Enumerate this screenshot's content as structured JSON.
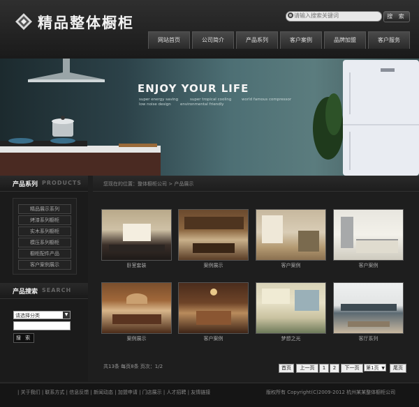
{
  "header": {
    "site_title": "精品整体橱柜",
    "search_placeholder": "请输入搜索关键词",
    "search_button": "搜 索",
    "nav": [
      "网站首页",
      "公司简介",
      "产品系列",
      "客户案例",
      "品牌加盟",
      "客户服务"
    ]
  },
  "banner": {
    "headline": "ENJOY YOUR LIFE",
    "features_line1": [
      "super energy saving",
      "super tropical cooling",
      "world famous compressor"
    ],
    "features_line2": [
      "low noise design",
      "environmental friendly"
    ]
  },
  "sidebar": {
    "products_title": "产品系列",
    "products_title_en": "PRODUCTS",
    "categories": [
      "精品展示系列",
      "烤漆系列橱柜",
      "实木系列橱柜",
      "模压系列橱柜",
      "橱柜配件产品",
      "客户案例展示"
    ],
    "search_title": "产品搜索",
    "search_title_en": "SEARCH",
    "select_placeholder": "请选择分类",
    "search_button": "搜 索"
  },
  "main": {
    "breadcrumb": "您现在的位置：整体橱柜公司 > 产品展示",
    "products": [
      {
        "caption": "卧室套装"
      },
      {
        "caption": "案例展示"
      },
      {
        "caption": "客户案例"
      },
      {
        "caption": "客户案例"
      },
      {
        "caption": "案例展示"
      },
      {
        "caption": "客户案例"
      },
      {
        "caption": "梦想之光"
      },
      {
        "caption": "客厅系列"
      }
    ],
    "pagination": {
      "info": "共13条  每页8条  页次：1/2",
      "first": "首页",
      "prev": "上一页",
      "page1": "1",
      "page2": "2",
      "next": "下一页",
      "page_select": "第1页",
      "last": "尾页"
    }
  },
  "footer": {
    "links": [
      "关于我们",
      "联系方式",
      "信息反馈",
      "新闻动态",
      "加盟申请",
      "门店展示",
      "人才招聘",
      "友情链接"
    ],
    "copyright": "版权所有 Copyright(C)2009-2012 杭州某某整体橱柜公司"
  },
  "colors": {
    "background": "#1e1e1e",
    "accent": "#3f5f63"
  }
}
